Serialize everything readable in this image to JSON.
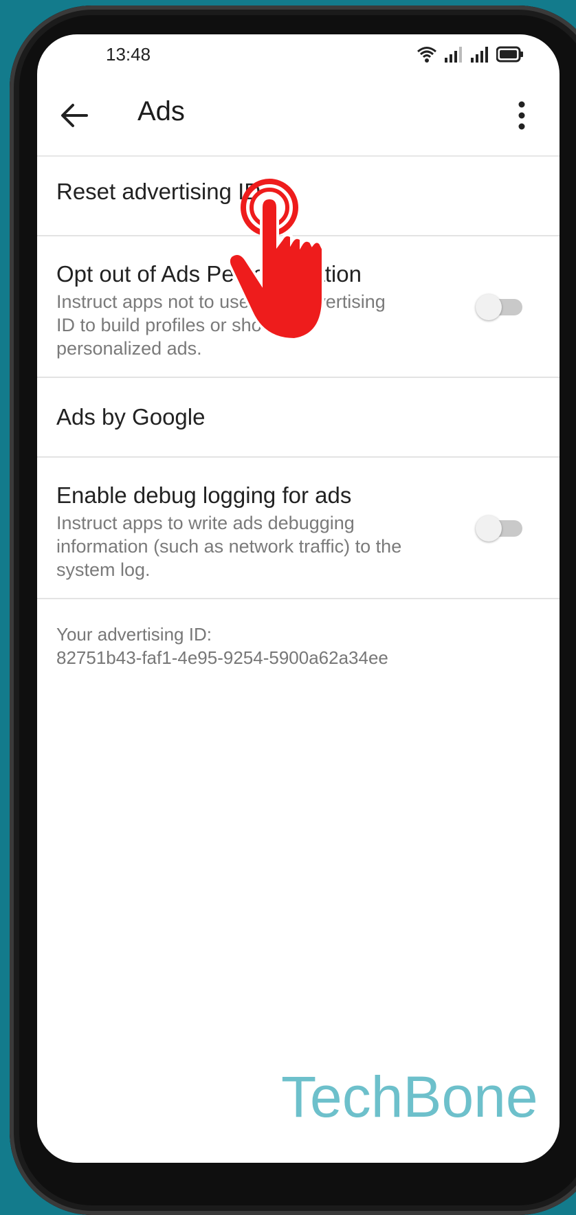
{
  "status_bar": {
    "time": "13:48",
    "icons": [
      "wifi-icon",
      "signal-icon",
      "signal-icon",
      "battery-icon"
    ]
  },
  "app_bar": {
    "title": "Ads",
    "back_icon": "arrow-left-icon",
    "more_icon": "more-vertical-icon"
  },
  "settings": {
    "reset_ad_id": {
      "title": "Reset advertising ID"
    },
    "opt_out": {
      "title": "Opt out of Ads Personalization",
      "description": "Instruct apps not to use your advertising ID to build profiles or show you personalized ads.",
      "enabled": false
    },
    "ads_by_google": {
      "title": "Ads by Google"
    },
    "debug_logging": {
      "title": "Enable debug logging for ads",
      "description": "Instruct apps to write ads debugging information (such as network traffic) to the system log.",
      "enabled": false
    }
  },
  "advertising_id": {
    "label": "Your advertising ID:",
    "value": "82751b43-faf1-4e95-9254-5900a62a34ee"
  },
  "overlay": {
    "tap_indicator_icon": "tap-hand-icon",
    "watermark": "TechBone"
  },
  "colors": {
    "background": "#137b8c",
    "tap_indicator": "#ee1c1c",
    "watermark": "#6dc0cb",
    "toggle_off_track": "#c9c9c9"
  }
}
